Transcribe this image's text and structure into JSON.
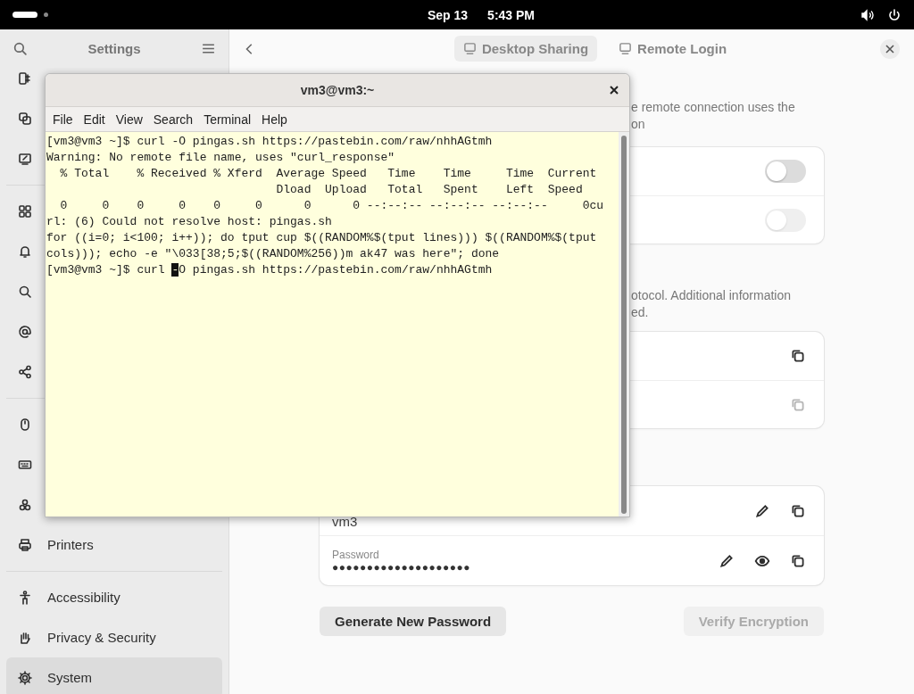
{
  "top_bar": {
    "date": "Sep 13",
    "time": "5:43 PM"
  },
  "sidebar": {
    "title": "Settings",
    "groups": [
      [
        {
          "selected": false
        },
        {
          "selected": false
        },
        {
          "selected": false
        }
      ],
      [
        {
          "selected": false
        },
        {
          "selected": false
        },
        {
          "selected": false
        },
        {
          "selected": false
        },
        {
          "selected": false
        }
      ],
      [
        {
          "selected": false
        },
        {
          "selected": false
        },
        {
          "selected": false
        },
        {
          "label": "Printers",
          "selected": false
        }
      ],
      [
        {
          "label": "Accessibility",
          "selected": false
        },
        {
          "label": "Privacy & Security",
          "selected": false
        },
        {
          "label": "System",
          "selected": true
        }
      ]
    ]
  },
  "header": {
    "tabs": [
      {
        "label": "Desktop Sharing",
        "selected": true
      },
      {
        "label": "Remote Login",
        "selected": false
      }
    ]
  },
  "content": {
    "intro": [
      "e remote connection uses the",
      "on"
    ],
    "switches": [
      {
        "on": false,
        "disabled": false
      },
      {
        "on": false,
        "disabled": true
      }
    ],
    "note": [
      "otocol. Additional information",
      "ed."
    ],
    "copy_rows": [
      {
        "disabled": false
      },
      {
        "disabled": true
      }
    ],
    "login": {
      "username": "vm3",
      "password_label": "Password",
      "password": "●●●●●●●●●●●●●●●●●●●●"
    },
    "buttons": [
      {
        "label": "Generate New Password",
        "disabled": false
      },
      {
        "label": "Verify Encryption",
        "disabled": true
      }
    ]
  },
  "terminal": {
    "title": "vm3@vm3:~",
    "menu": [
      "File",
      "Edit",
      "View",
      "Search",
      "Terminal",
      "Help"
    ],
    "lines": [
      "[vm3@vm3 ~]$ curl -O pingas.sh https://pastebin.com/raw/nhhAGtmh",
      "Warning: No remote file name, uses \"curl_response\"",
      "  % Total    % Received % Xferd  Average Speed   Time    Time     Time  Current",
      "                                 Dload  Upload   Total   Spent    Left  Speed",
      "  0     0    0     0    0     0      0      0 --:--:-- --:--:-- --:--:--     0cu",
      "rl: (6) Could not resolve host: pingas.sh",
      "for ((i=0; i<100; i++)); do tput cup $((RANDOM%$(tput lines))) $((RANDOM%$(tput",
      "cols))); echo -e \"\\033[38;5;$((RANDOM%256))m ak47 was here\"; done"
    ],
    "cursor_line": {
      "before": "[vm3@vm3 ~]$ curl ",
      "cursor": "-",
      "after": "O pingas.sh https://pastebin.com/raw/nhhAGtmh"
    }
  }
}
